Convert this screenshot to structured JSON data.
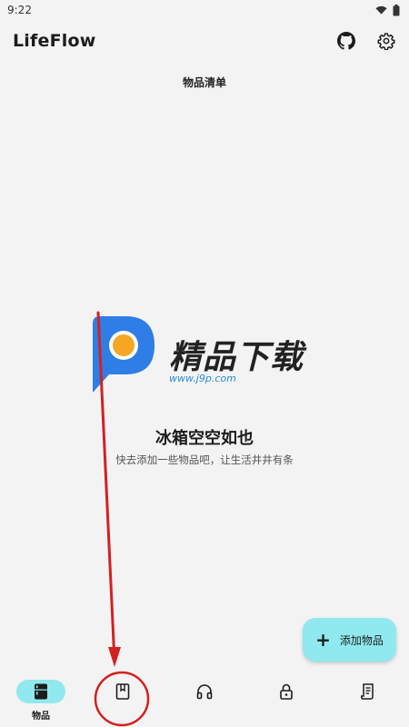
{
  "status_bar": {
    "time": "9:22"
  },
  "app": {
    "title": "LifeFlow"
  },
  "section": {
    "title": "物品清单"
  },
  "watermark": {
    "text": "精品下载",
    "url": "www.j9p.com"
  },
  "empty_state": {
    "title": "冰箱空空如也",
    "subtitle": "快去添加一些物品吧，让生活井井有条"
  },
  "fab": {
    "label": "添加物品",
    "icon": "plus-icon"
  },
  "bottom_nav": {
    "items": [
      {
        "label": "物品",
        "icon": "fridge-icon",
        "active": true
      },
      {
        "label": "",
        "icon": "book-icon",
        "active": false
      },
      {
        "label": "",
        "icon": "headphones-icon",
        "active": false
      },
      {
        "label": "",
        "icon": "lock-icon",
        "active": false
      },
      {
        "label": "",
        "icon": "receipt-icon",
        "active": false
      }
    ]
  },
  "colors": {
    "accent": "#8fe9ee",
    "background": "#f3f3f3",
    "annotation": "#d42020"
  }
}
